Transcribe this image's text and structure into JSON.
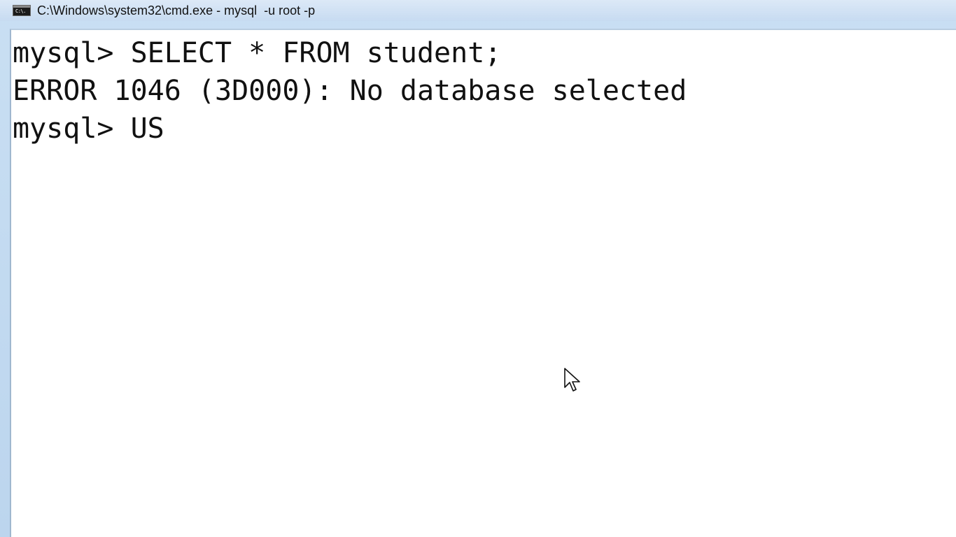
{
  "window": {
    "title": "C:\\Windows\\system32\\cmd.exe - mysql  -u root -p",
    "icon": "console-app-icon",
    "icon_label": "C:\\."
  },
  "console": {
    "lines": [
      "mysql> SELECT * FROM student;",
      "ERROR 1046 (3D000): No database selected",
      "mysql> US"
    ]
  },
  "pointer": {
    "icon": "mouse-pointer-icon"
  },
  "colors": {
    "titlebar": "#c7dbf1",
    "console_background": "#ffffff",
    "text": "#111111"
  }
}
